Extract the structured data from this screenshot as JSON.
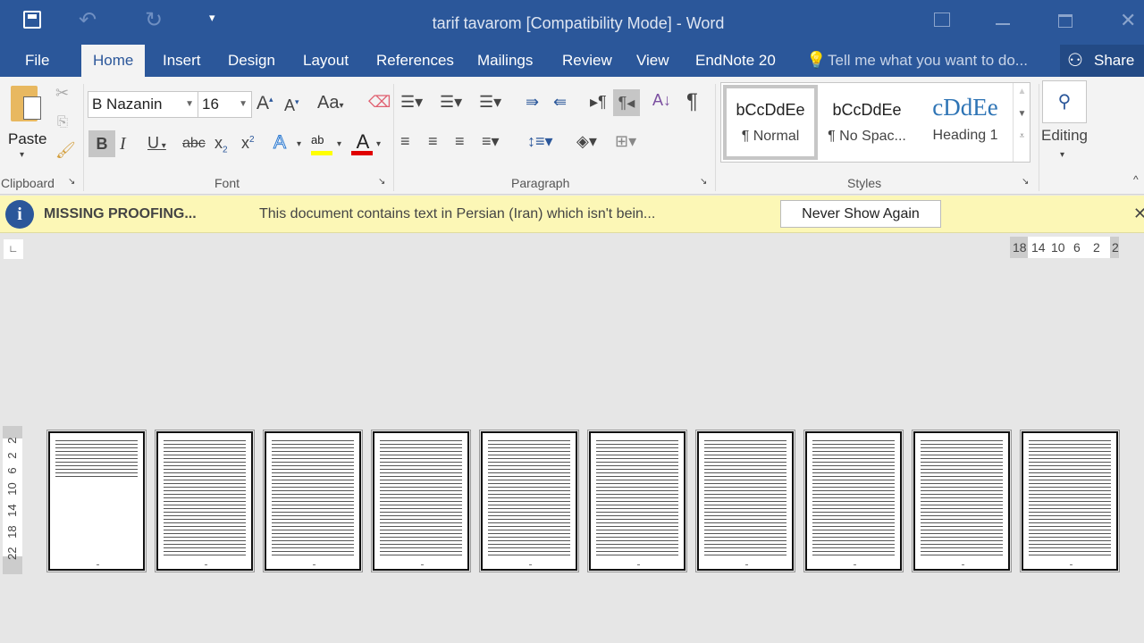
{
  "title": "tarif tavarom [Compatibility Mode] - Word",
  "qat": {
    "save_icon": "save-icon",
    "undo_icon": "undo-icon",
    "redo_icon": "redo-icon",
    "customize_icon": "customize-qat-icon"
  },
  "window": {
    "restore_ribbon": "ribbon-display-icon",
    "minimize": "minimize-icon",
    "maximize": "maximize-icon",
    "close": "close-icon"
  },
  "tabs": [
    "File",
    "Home",
    "Insert",
    "Design",
    "Layout",
    "References",
    "Mailings",
    "Review",
    "View",
    "EndNote 20"
  ],
  "tell_me": "Tell me what you want to do...",
  "share": "Share",
  "clipboard": {
    "paste": "Paste",
    "label": "Clipboard"
  },
  "font": {
    "name": "B Nazanin",
    "size": "16",
    "label": "Font",
    "change_case": "Aa",
    "bold": "B",
    "italic": "I",
    "underline": "U",
    "strike": "abc",
    "sub": "x",
    "sup": "x",
    "sub_n": "2",
    "sup_n": "2",
    "highlight_color": "#ffff00",
    "font_color": "#e00000"
  },
  "paragraph": {
    "label": "Paragraph"
  },
  "styles": {
    "label": "Styles",
    "items": [
      {
        "preview": "bCcDdEe",
        "name": "¶ Normal"
      },
      {
        "preview": "bCcDdEe",
        "name": "¶ No Spac..."
      },
      {
        "preview": "cDdEe",
        "name": "Heading 1"
      }
    ]
  },
  "editing": {
    "label": "Editing"
  },
  "message_bar": {
    "title": "MISSING PROOFING...",
    "text": "This document contains text in Persian (Iran) which isn't bein...",
    "button": "Never Show Again"
  },
  "ruler": {
    "h": [
      "18",
      "14",
      "10",
      "6",
      "2",
      "2"
    ],
    "v": [
      "2",
      "2",
      "6",
      "10",
      "14",
      "18",
      "22"
    ]
  },
  "pages": 10,
  "accent": "#2b579a"
}
